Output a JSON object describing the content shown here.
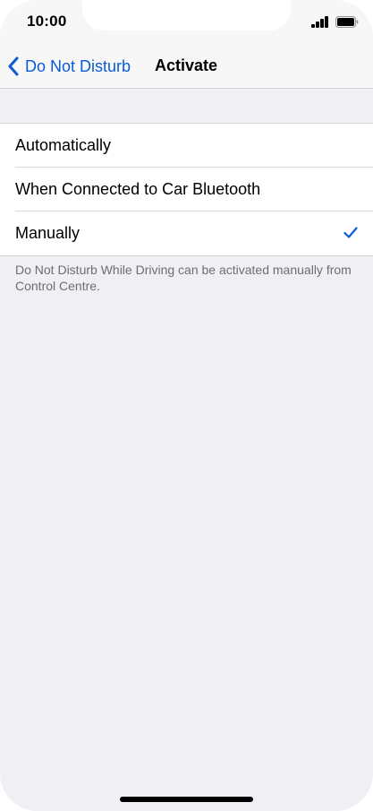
{
  "status_bar": {
    "time": "10:00"
  },
  "nav": {
    "back_label": "Do Not Disturb",
    "title": "Activate"
  },
  "options": [
    {
      "label": "Automatically",
      "selected": false
    },
    {
      "label": "When Connected to Car Bluetooth",
      "selected": false
    },
    {
      "label": "Manually",
      "selected": true
    }
  ],
  "footer_note": "Do Not Disturb While Driving can be activated manually from Control Centre.",
  "colors": {
    "accent": "#0a5bd5",
    "background": "#efeff4",
    "secondary_text": "#6d6d72"
  },
  "icons": {
    "back": "chevron-left-icon",
    "selected": "checkmark-icon",
    "signal": "cellular-signal-icon",
    "battery": "battery-icon"
  }
}
